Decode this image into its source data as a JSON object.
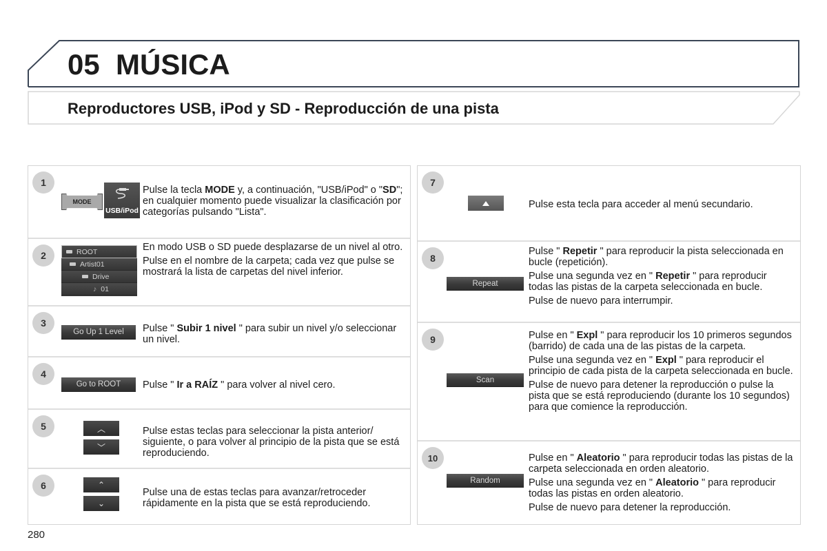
{
  "chapter": {
    "number": "05",
    "title": "MÚSICA",
    "full": "05  MÚSICA"
  },
  "section": {
    "title": "Reproductores USB, iPod y SD - Reproducción de una pista"
  },
  "left_steps": [
    {
      "number": "1",
      "images": {
        "mode_key": "MODE",
        "usb_key": "USB/iPod"
      },
      "paragraphs": [
        [
          "Pulse la tecla ",
          {
            "b": "MODE"
          },
          " y, a continuación, \"USB/iPod\" o \"",
          {
            "b": "SD"
          },
          "\"; en cualquier momento puede visualizar la clasificación por categorías pulsando \"Lista\"."
        ]
      ]
    },
    {
      "number": "2",
      "tree": [
        "ROOT",
        "Artist01",
        "Drive",
        "01"
      ],
      "paragraphs": [
        [
          "En modo USB o SD puede desplazarse de un nivel al otro."
        ],
        [
          "Pulse en el nombre de la carpeta; cada vez que pulse se mostrará la lista de carpetas del nivel inferior."
        ]
      ]
    },
    {
      "number": "3",
      "button": "Go Up 1 Level",
      "paragraphs": [
        [
          "Pulse \" ",
          {
            "b": "Subir 1 nivel"
          },
          " \" para subir un nivel y/o seleccionar un nivel."
        ]
      ]
    },
    {
      "number": "4",
      "button": "Go to ROOT",
      "paragraphs": [
        [
          "Pulse \" ",
          {
            "b": "Ir a RAÍZ"
          },
          " \" para volver al nivel cero."
        ]
      ]
    },
    {
      "number": "5",
      "buttons": [
        "chevron-up",
        "chevron-down"
      ],
      "paragraphs": [
        [
          "Pulse estas teclas para seleccionar la pista anterior/ siguiente, o para volver al principio de la pista que se está reproduciendo."
        ]
      ]
    },
    {
      "number": "6",
      "buttons": [
        "double-chevron-up",
        "double-chevron-down"
      ],
      "paragraphs": [
        [
          "Pulse una de estas teclas para avanzar/retroceder rápidamente en la pista que se está reproduciendo."
        ]
      ]
    }
  ],
  "right_steps": [
    {
      "number": "7",
      "button": "triangle-up",
      "paragraphs": [
        [
          "Pulse esta tecla para acceder al menú secundario."
        ]
      ]
    },
    {
      "number": "8",
      "button": "Repeat",
      "paragraphs": [
        [
          "Pulse \" ",
          {
            "b": "Repetir"
          },
          " \" para reproducir la pista seleccionada en bucle (repetición)."
        ],
        [
          "Pulse una segunda vez en \" ",
          {
            "b": "Repetir"
          },
          " \" para reproducir todas las pistas de la carpeta seleccionada en bucle."
        ],
        [
          "Pulse de nuevo para interrumpir."
        ]
      ]
    },
    {
      "number": "9",
      "button": "Scan",
      "paragraphs": [
        [
          "Pulse en \" ",
          {
            "b": "Expl"
          },
          " \" para reproducir los 10 primeros segundos (barrido) de cada una de las pistas de la carpeta."
        ],
        [
          "Pulse una segunda vez en \" ",
          {
            "b": "Expl"
          },
          " \" para reproducir el principio de cada pista de la carpeta seleccionada en bucle."
        ],
        [
          "Pulse de nuevo para detener la reproducción o pulse la pista que se está reproduciendo (durante los 10 segundos) para que comience la reproducción."
        ]
      ]
    },
    {
      "number": "10",
      "button": "Random",
      "paragraphs": [
        [
          "Pulse en \" ",
          {
            "b": "Aleatorio"
          },
          " \" para reproducir todas las pistas de la carpeta seleccionada en orden aleatorio."
        ],
        [
          "Pulse una segunda vez en \" ",
          {
            "b": "Aleatorio"
          },
          " \" para reproducir todas las pistas en orden aleatorio."
        ],
        [
          "Pulse de nuevo para detener la reproducción."
        ]
      ]
    }
  ],
  "page_number": "280",
  "colors": {
    "frame": "#3b4656",
    "badge": "#d2d2d2",
    "button_dark": "#3a3a3a",
    "divider": "#dedede"
  }
}
